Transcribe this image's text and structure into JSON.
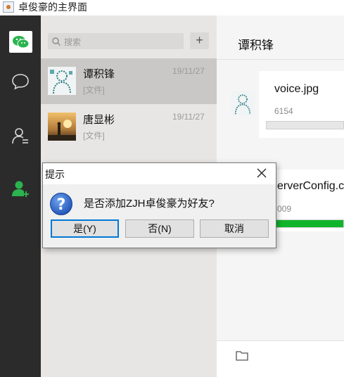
{
  "window": {
    "title": "卓俊豪的主界面"
  },
  "search": {
    "placeholder": "搜索",
    "add_label": "+"
  },
  "conversations": [
    {
      "name": "谭积锋",
      "preview": "[文件]",
      "date": "19/11/27",
      "selected": true
    },
    {
      "name": "唐显彬",
      "preview": "[文件]",
      "date": "19/11/27",
      "selected": false
    }
  ],
  "chat": {
    "title": "谭积锋",
    "messages": [
      {
        "file_name": "voice.jpg",
        "file_size": "6154",
        "progress": 0
      },
      {
        "file_name": "erverConfig.c",
        "file_size": "009",
        "progress": 1
      }
    ]
  },
  "dialog": {
    "title": "提示",
    "message": "是否添加ZJH卓俊豪为好友?",
    "buttons": {
      "yes": "是(Y)",
      "no": "否(N)",
      "cancel": "取消"
    }
  },
  "colors": {
    "accent_green": "#10b52b",
    "nav_bg": "#2b2b2b",
    "list_bg": "#e8e6e5",
    "selected_row": "#c9c8c6",
    "dialog_focus": "#0078d7"
  },
  "icons": {
    "nav": [
      "chat-bubble-icon",
      "contacts-icon",
      "add-friend-icon"
    ],
    "dialog": [
      "question-icon",
      "close-icon"
    ],
    "toolbar": [
      "folder-icon",
      "search-icon"
    ]
  }
}
